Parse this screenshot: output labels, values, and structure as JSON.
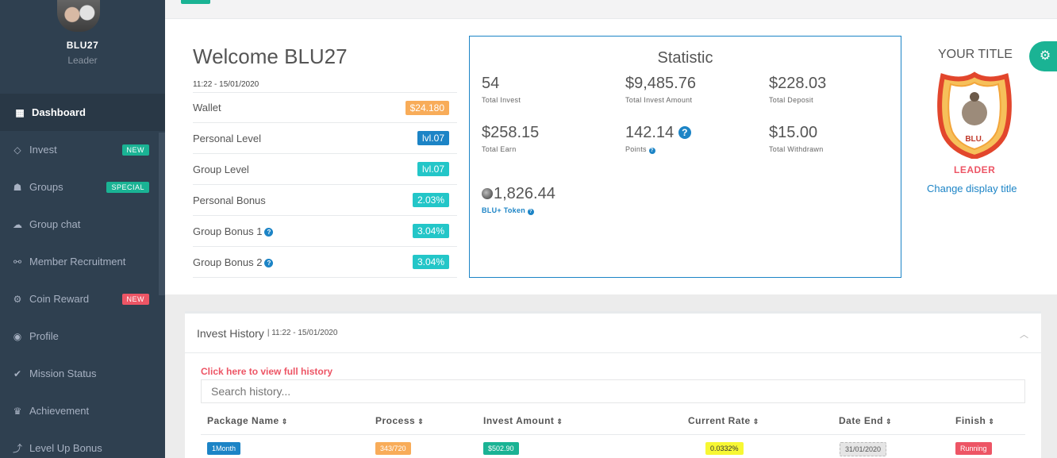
{
  "user": {
    "name": "BLU27",
    "role": "Leader"
  },
  "sidebar": {
    "items": [
      {
        "label": "Dashboard",
        "icon": "dashboard-icon",
        "glyph": "▦",
        "badge": ""
      },
      {
        "label": "Invest",
        "icon": "diamond-icon",
        "glyph": "◇",
        "badge": "NEW"
      },
      {
        "label": "Groups",
        "icon": "users-icon",
        "glyph": "☗",
        "badge": "SPECIAL"
      },
      {
        "label": "Group chat",
        "icon": "chat-icon",
        "glyph": "☁",
        "badge": ""
      },
      {
        "label": "Member Recruitment",
        "icon": "handshake-icon",
        "glyph": "⚯",
        "badge": ""
      },
      {
        "label": "Coin Reward",
        "icon": "gear-icon",
        "glyph": "⚙",
        "badge": "NEW"
      },
      {
        "label": "Profile",
        "icon": "user-circle-icon",
        "glyph": "◉",
        "badge": ""
      },
      {
        "label": "Mission Status",
        "icon": "check-circle-icon",
        "glyph": "✔",
        "badge": ""
      },
      {
        "label": "Achievement",
        "icon": "trophy-icon",
        "glyph": "♛",
        "badge": ""
      },
      {
        "label": "Level Up Bonus",
        "icon": "level-up-icon",
        "glyph": "⤴",
        "badge": ""
      }
    ]
  },
  "welcome": {
    "title": "Welcome BLU27",
    "time": "11:22 - 15/01/2020",
    "rows": [
      {
        "label": "Wallet",
        "value": "$24.180",
        "color": "#f8ac59",
        "help": false
      },
      {
        "label": "Personal Level",
        "value": "lvl.07",
        "color": "#1c84c6",
        "help": false
      },
      {
        "label": "Group Level",
        "value": "lvl.07",
        "color": "#23c6c8",
        "help": false
      },
      {
        "label": "Personal Bonus",
        "value": "2.03%",
        "color": "#23c6c8",
        "help": false
      },
      {
        "label": "Group Bonus 1",
        "value": "3.04%",
        "color": "#23c6c8",
        "help": true
      },
      {
        "label": "Group Bonus 2",
        "value": "3.04%",
        "color": "#23c6c8",
        "help": true
      }
    ]
  },
  "statistic": {
    "title": "Statistic",
    "total_invest": {
      "value": "54",
      "label": "Total Invest"
    },
    "total_invest_amount": {
      "value": "$9,485.76",
      "label": "Total Invest Amount"
    },
    "total_deposit": {
      "value": "$228.03",
      "label": "Total Deposit"
    },
    "total_earn": {
      "value": "$258.15",
      "label": "Total Earn"
    },
    "points": {
      "value": "142.14",
      "label": "Points"
    },
    "total_withdrawn": {
      "value": "$15.00",
      "label": "Total Withdrawn"
    },
    "token": {
      "value": "1,826.44",
      "label": "BLU+ Token"
    }
  },
  "title_card": {
    "heading": "YOUR TITLE",
    "emblem_text": "BLU.",
    "rank": "LEADER",
    "change_link": "Change display title"
  },
  "history": {
    "title": "Invest History",
    "time": "| 11:22 - 15/01/2020",
    "view_full": "Click here to view full history",
    "search_placeholder": "Search history...",
    "columns": [
      "Package Name",
      "Process",
      "Invest Amount",
      "Current Rate",
      "Date End",
      "Finish"
    ],
    "row": {
      "package": "1Month",
      "process": "343/720",
      "amount": "$502.90",
      "rate": "0.0332%",
      "date_end": "31/01/2020",
      "finish": "Running"
    }
  },
  "colors": {
    "accent": "#1ab394",
    "sidebar": "#2f4050",
    "primary": "#1c84c6",
    "danger": "#ed5565",
    "warning": "#f8ac59",
    "info": "#23c6c8"
  }
}
